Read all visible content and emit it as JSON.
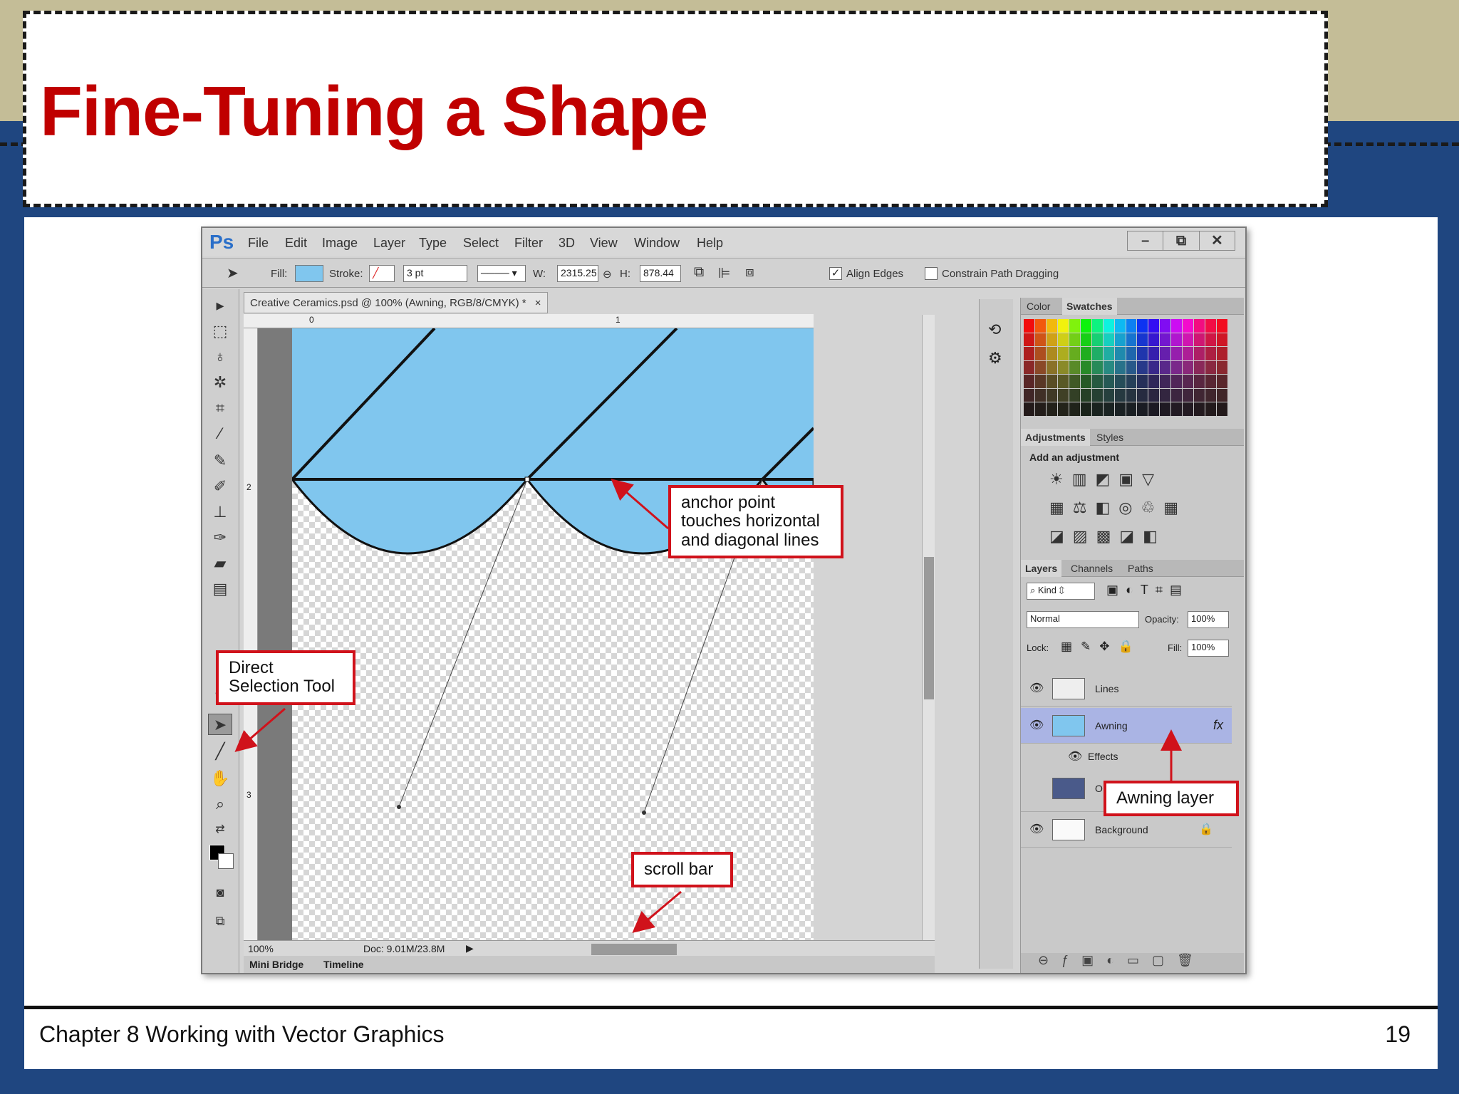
{
  "slide": {
    "title": "Fine-Tuning a Shape",
    "footer": "Chapter 8 Working with Vector Graphics",
    "page_number": "19"
  },
  "app": {
    "logo": "Ps",
    "menu": [
      "File",
      "Edit",
      "Image",
      "Layer",
      "Type",
      "Select",
      "Filter",
      "3D",
      "View",
      "Window",
      "Help"
    ],
    "window_buttons": [
      "–",
      "⧉",
      "✕"
    ]
  },
  "options_bar": {
    "fill_label": "Fill:",
    "stroke_label": "Stroke:",
    "stroke_size": "3 pt",
    "w_label": "W:",
    "w_value": "2315.25",
    "h_label": "H:",
    "h_value": "878.44",
    "align_edges_label": "Align Edges",
    "align_edges_checked": true,
    "constrain_label": "Constrain Path Dragging",
    "constrain_checked": false,
    "fill_color": "#80c6ee"
  },
  "document": {
    "tab_title": "Creative Ceramics.psd @ 100% (Awning, RGB/8/CMYK) *",
    "tab_close": "×",
    "zoom": "100%",
    "doc_info": "Doc: 9.01M/23.8M",
    "ruler_marks": [
      "0",
      "1",
      "2"
    ],
    "vruler_marks": [
      "2",
      "3"
    ],
    "bottom_tabs": [
      "Mini Bridge",
      "Timeline"
    ]
  },
  "panels": {
    "color_tabs": [
      "Color",
      "Swatches"
    ],
    "adjust_tabs": [
      "Adjustments",
      "Styles"
    ],
    "add_adjustment": "Add an adjustment",
    "layer_tabs": [
      "Layers",
      "Channels",
      "Paths"
    ],
    "kind_label": "Kind",
    "blend_mode": "Normal",
    "opacity_label": "Opacity:",
    "opacity_value": "100%",
    "lock_label": "Lock:",
    "fill_label": "Fill:",
    "fill_value": "100%",
    "layers": [
      {
        "name": "Lines"
      },
      {
        "name": "Awning",
        "selected": true
      },
      {
        "name": "Effects"
      },
      {
        "name": "O"
      },
      {
        "name": "Background"
      }
    ]
  },
  "callouts": {
    "anchor_point": "anchor point touches horizontal and diagonal lines",
    "direct_selection": "Direct Selection Tool",
    "awning_layer": "Awning layer",
    "scroll_bar": "scroll bar"
  },
  "colors": {
    "title_red": "#c00000",
    "callout_red": "#d0121b",
    "slide_blue": "#1f4680",
    "band_tan": "#c4bd97",
    "awning_blue": "#80c6ee",
    "selected_layer": "#aab4e4"
  }
}
